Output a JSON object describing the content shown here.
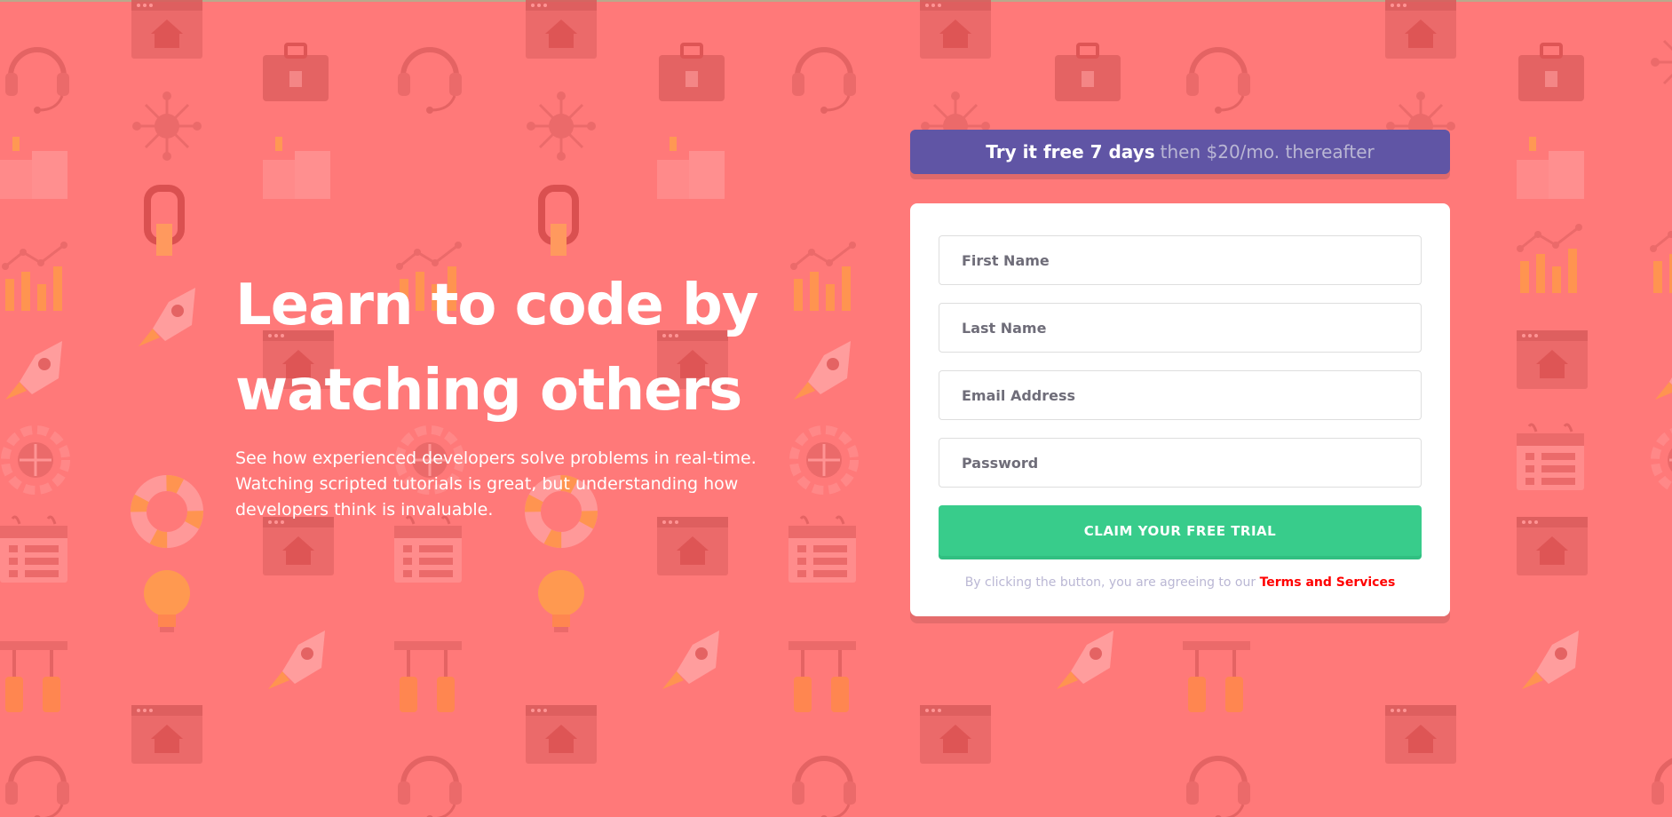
{
  "theme": {
    "background": "#ff7979",
    "banner": "#6055a5",
    "cta": "#38cc8b",
    "link": "#ff0000"
  },
  "hero": {
    "title_line1": "Learn to code by",
    "title_line2": "watching others",
    "description": "See how experienced developers solve problems in real-time. Watching scripted tutorials is great, but understanding how developers think is invaluable."
  },
  "banner": {
    "bold": "Try it free 7 days",
    "rest": "then $20/mo. thereafter"
  },
  "form": {
    "first_name_placeholder": "First Name",
    "last_name_placeholder": "Last Name",
    "email_placeholder": "Email Address",
    "password_placeholder": "Password",
    "cta_label": "Claim your free trial",
    "terms_prefix": "By clicking the button, you are agreeing to our",
    "terms_link": "Terms and Services"
  },
  "background_icons": [
    "computer-house-icon",
    "toolbox-icon",
    "headset-icon",
    "network-icon",
    "like-icon",
    "hook-icon",
    "chart-icon",
    "rocket-icon",
    "gear-globe-icon",
    "lifebuoy-icon",
    "calendar-icon",
    "lightbulb-icon",
    "tools-icon"
  ]
}
